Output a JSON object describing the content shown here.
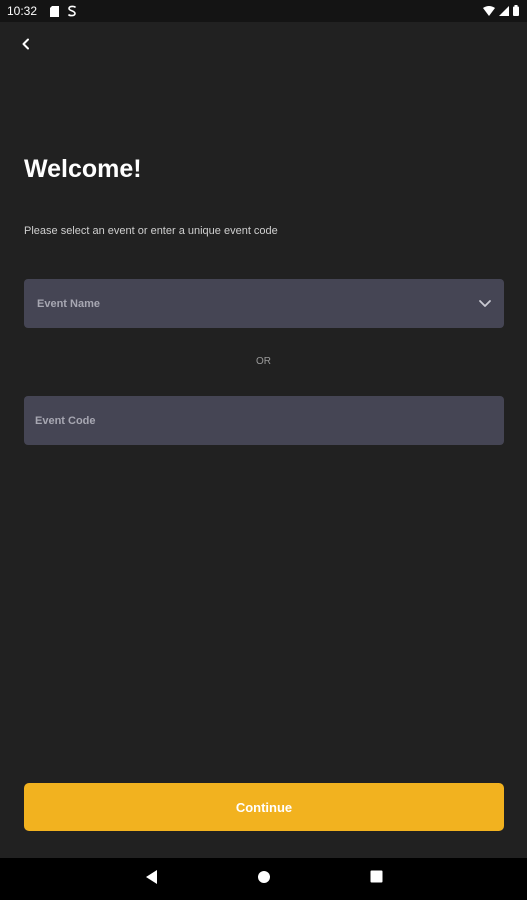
{
  "status_bar": {
    "time": "10:32",
    "left_icons": [
      "sim-card-icon",
      "s-app-icon"
    ],
    "right_icons": [
      "wifi-icon",
      "cellular-signal-icon",
      "battery-icon"
    ]
  },
  "header": {
    "back_icon": "chevron-left-icon"
  },
  "main": {
    "title": "Welcome!",
    "subtitle": "Please select an event or enter a unique event code",
    "event_name_select": {
      "placeholder": "Event Name",
      "icon": "chevron-down-icon"
    },
    "or_label": "OR",
    "event_code_input": {
      "placeholder": "Event Code",
      "value": ""
    },
    "continue_label": "Continue"
  },
  "nav_bar": {
    "buttons": [
      "nav-back-icon",
      "nav-home-icon",
      "nav-recents-icon"
    ]
  },
  "colors": {
    "background": "#212121",
    "field": "#454554",
    "accent": "#f2b21f"
  }
}
